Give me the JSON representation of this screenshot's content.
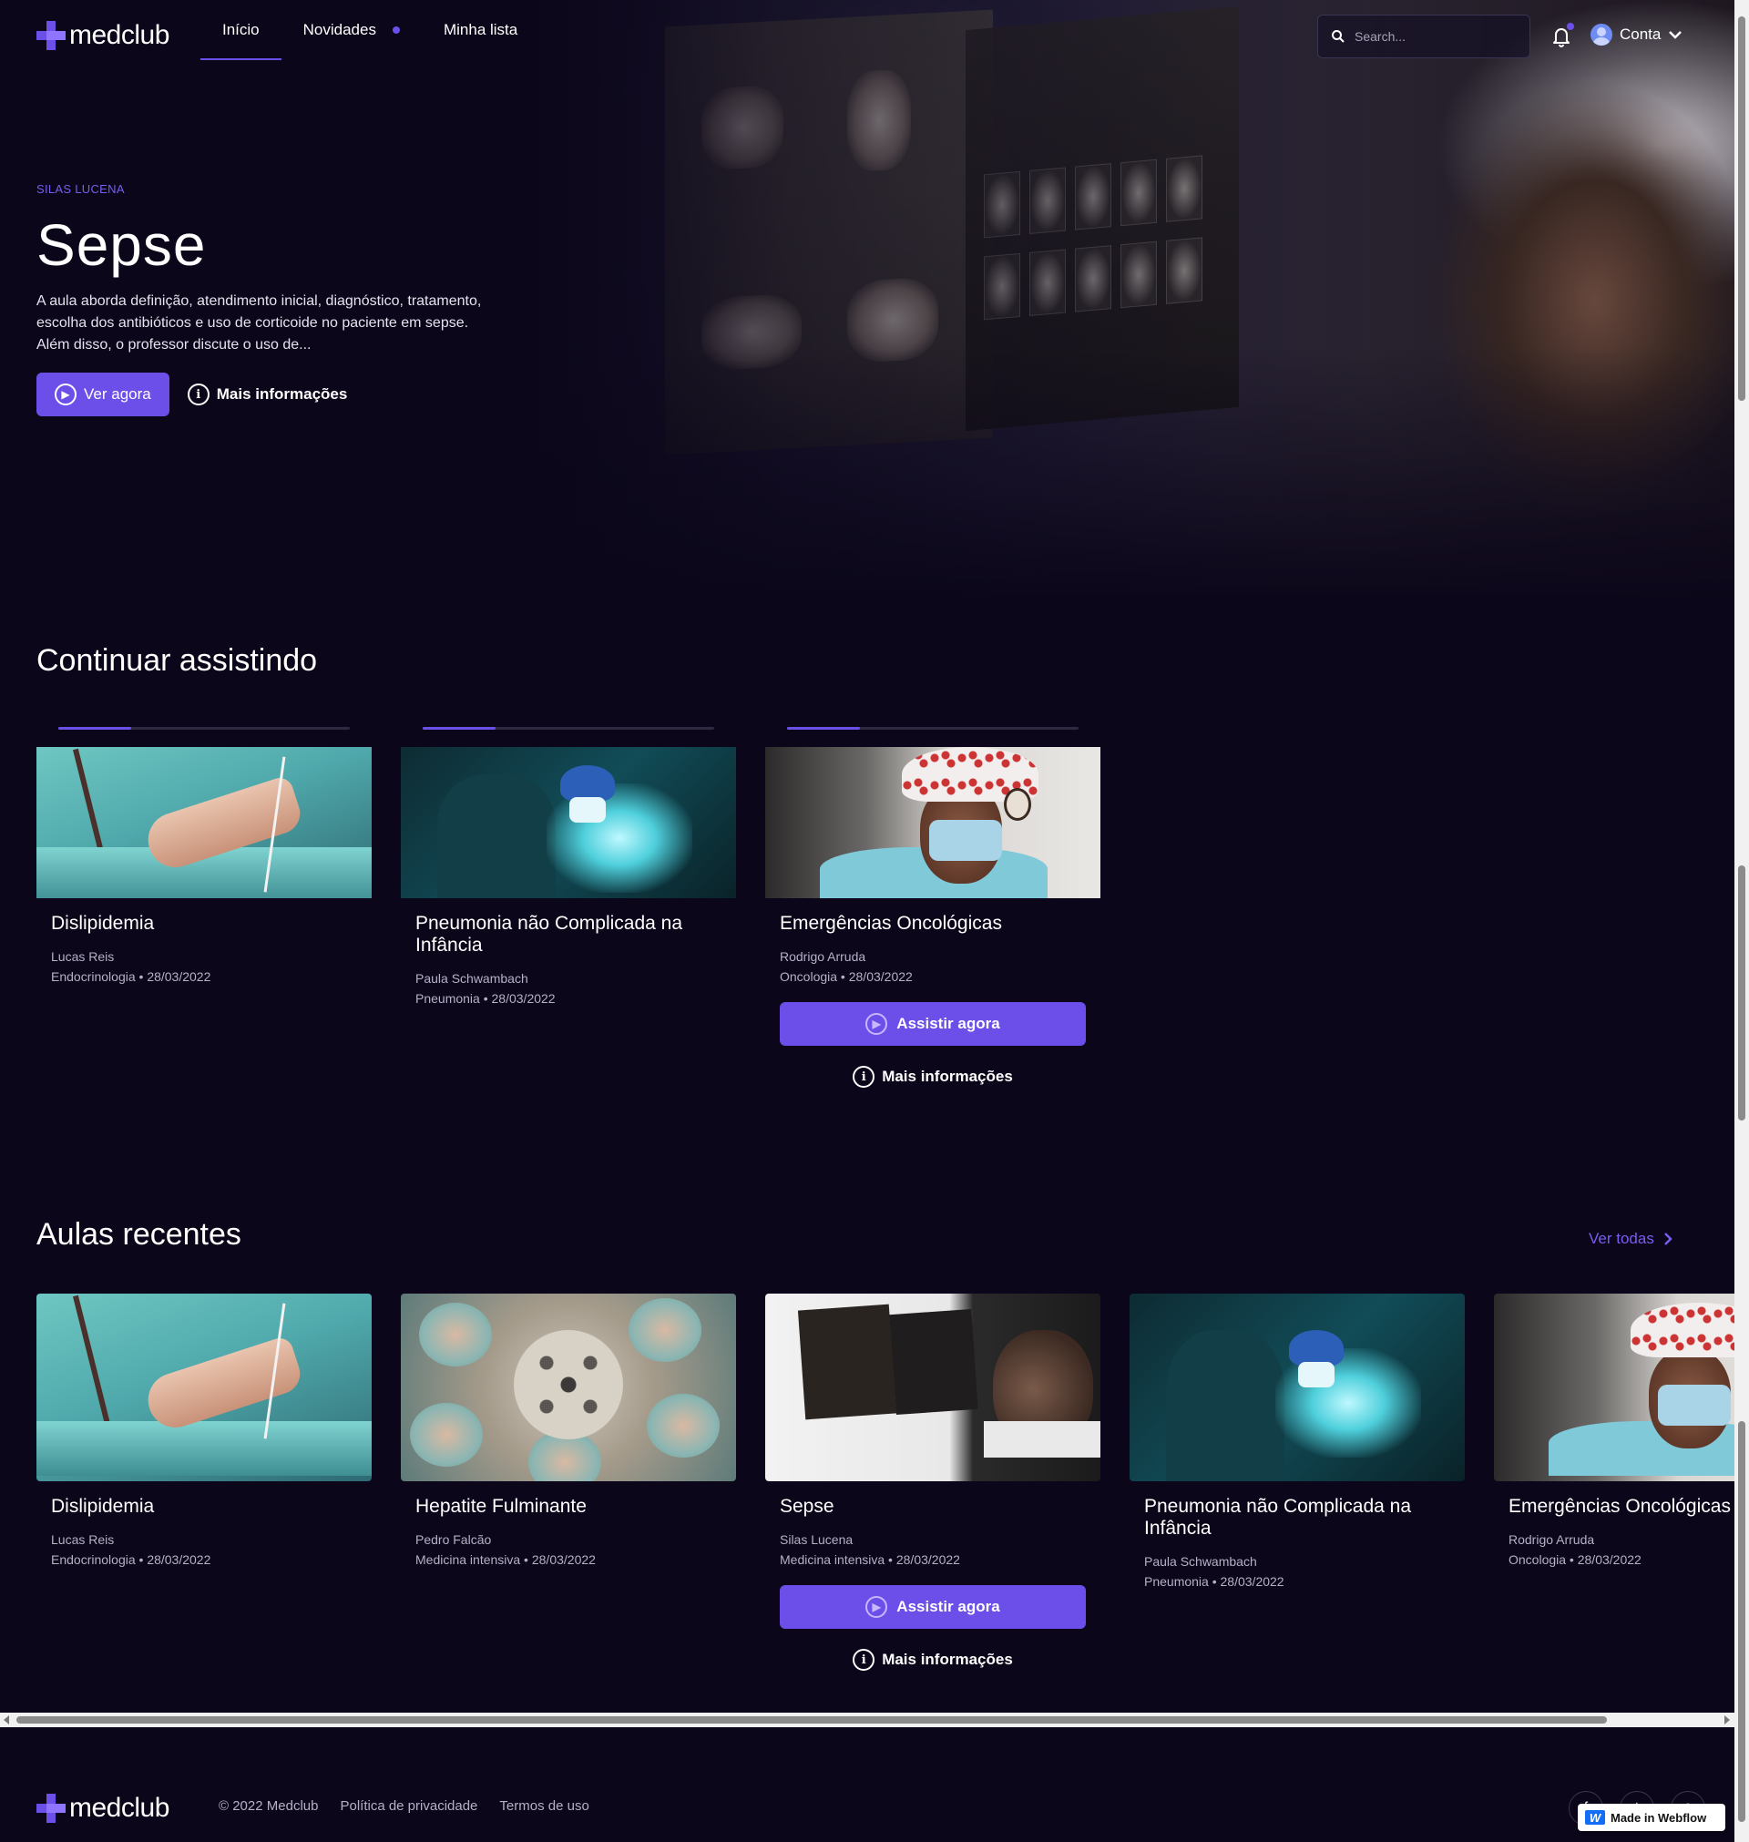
{
  "brand": {
    "name": "medclub",
    "accent": "#6c4fe8"
  },
  "nav": {
    "items": [
      {
        "label": "Início",
        "active": true
      },
      {
        "label": "Novidades",
        "has_dot": true
      },
      {
        "label": "Minha lista"
      }
    ],
    "search_placeholder": "Search...",
    "account_label": "Conta"
  },
  "hero": {
    "author": "SILAS LUCENA",
    "title": "Sepse",
    "description": "A aula aborda definição, atendimento inicial, diagnóstico, tratamento, escolha dos antibióticos e uso de corticoide no paciente em sepse. Além disso, o professor discute o uso de...",
    "primary_label": "Ver agora",
    "secondary_label": "Mais informações"
  },
  "continue": {
    "title": "Continuar assistindo",
    "cards": [
      {
        "title": "Dislipidemia",
        "author": "Lucas Reis",
        "category": "Endocrinologia",
        "date": "28/03/2022",
        "progress": 0.25,
        "thumb": "iv-drip"
      },
      {
        "title": "Pneumonia não Complicada na Infância",
        "author": "Paula Schwambach",
        "category": "Pneumonia",
        "date": "28/03/2022",
        "progress": 0.25,
        "thumb": "surgery"
      },
      {
        "title": "Emergências Oncológicas",
        "author": "Rodrigo Arruda",
        "category": "Oncologia",
        "date": "28/03/2022",
        "progress": 0.25,
        "thumb": "nurse",
        "expanded": true,
        "watch_label": "Assistir agora",
        "more_label": "Mais informações"
      }
    ]
  },
  "recent": {
    "title": "Aulas recentes",
    "see_all_label": "Ver todas",
    "cards": [
      {
        "title": "Dislipidemia",
        "author": "Lucas Reis",
        "category": "Endocrinologia",
        "date": "28/03/2022",
        "thumb": "iv-drip"
      },
      {
        "title": "Hepatite Fulminante",
        "author": "Pedro Falcão",
        "category": "Medicina intensiva",
        "date": "28/03/2022",
        "thumb": "surgeons-circle"
      },
      {
        "title": "Sepse",
        "author": "Silas Lucena",
        "category": "Medicina intensiva",
        "date": "28/03/2022",
        "thumb": "xray",
        "expanded": true,
        "watch_label": "Assistir agora",
        "more_label": "Mais informações"
      },
      {
        "title": "Pneumonia não Complicada na Infância",
        "author": "Paula Schwambach",
        "category": "Pneumonia",
        "date": "28/03/2022",
        "thumb": "surgery"
      },
      {
        "title": "Emergências Oncológicas",
        "author": "Rodrigo Arruda",
        "category": "Oncologia",
        "date": "28/03/2022",
        "thumb": "nurse"
      }
    ]
  },
  "footer": {
    "copyright": "© 2022",
    "company": "Medclub",
    "privacy": "Política de privacidade",
    "terms": "Termos de uso",
    "socials": [
      "facebook-icon",
      "twitter-icon",
      "instagram-icon"
    ],
    "badge": "Made in Webflow"
  }
}
